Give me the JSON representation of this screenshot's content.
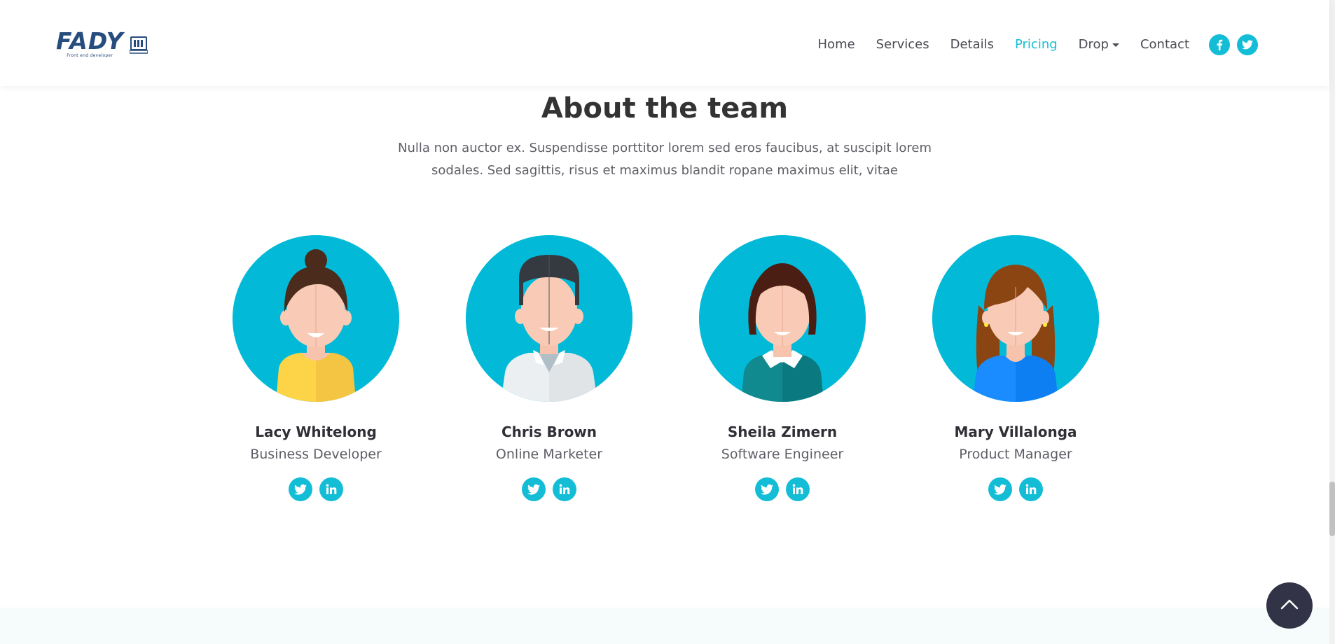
{
  "header": {
    "logo_text": "FADY",
    "logo_tagline": "Front end developer",
    "nav": [
      {
        "label": "Home"
      },
      {
        "label": "Services"
      },
      {
        "label": "Details"
      },
      {
        "label": "Pricing"
      },
      {
        "label": "Drop"
      },
      {
        "label": "Contact"
      }
    ],
    "active_nav": "Pricing",
    "social_icons": [
      "facebook-icon",
      "twitter-icon"
    ]
  },
  "section": {
    "title": "About the team",
    "subtitle_line1": "Nulla non auctor ex. Suspendisse porttitor lorem sed eros faucibus, at suscipit lorem",
    "subtitle_line2": "sodales. Sed sagittis, risus et maximus blandit ropane maximus elit, vitae"
  },
  "team": [
    {
      "name": "Lacy Whitelong",
      "role": "Business Developer",
      "social_icons": [
        "twitter-icon",
        "linkedin-icon"
      ]
    },
    {
      "name": "Chris Brown",
      "role": "Online Marketer",
      "social_icons": [
        "twitter-icon",
        "linkedin-icon"
      ]
    },
    {
      "name": "Sheila Zimern",
      "role": "Software Engineer",
      "social_icons": [
        "twitter-icon",
        "linkedin-icon"
      ]
    },
    {
      "name": "Mary Villalonga",
      "role": "Product Manager",
      "social_icons": [
        "twitter-icon",
        "linkedin-icon"
      ]
    }
  ],
  "colors": {
    "accent": "#14bdd6",
    "avatar_bg": "#02bad7",
    "heading": "#333333",
    "text": "#5e5e66",
    "back_to_top_bg": "#333347"
  },
  "back_to_top_icon": "chevron-up-icon"
}
